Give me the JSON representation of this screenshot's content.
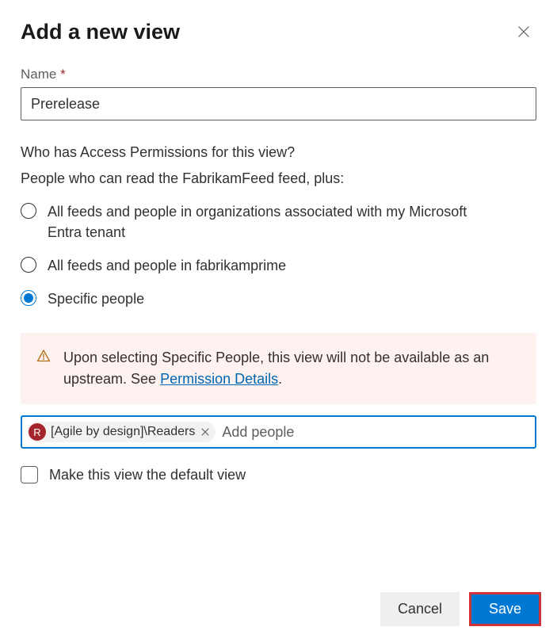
{
  "dialog": {
    "title": "Add a new view"
  },
  "nameField": {
    "label": "Name",
    "requiredMark": "*",
    "value": "Prerelease"
  },
  "permissions": {
    "question": "Who has Access Permissions for this view?",
    "subtext": "People who can read the FabrikamFeed feed, plus:",
    "options": {
      "opt0": {
        "label": "All feeds and people in organizations associated with my Microsoft Entra tenant",
        "checked": false
      },
      "opt1": {
        "label": "All feeds and people in fabrikamprime",
        "checked": false
      },
      "opt2": {
        "label": "Specific people",
        "checked": true
      }
    }
  },
  "infoBox": {
    "text": "Upon selecting Specific People, this view will not be available as an upstream. See ",
    "linkText": "Permission Details",
    "trailingText": "."
  },
  "peoplePicker": {
    "chip": {
      "avatarLetter": "R",
      "label": "[Agile by design]\\Readers"
    },
    "placeholder": "Add people"
  },
  "defaultView": {
    "label": "Make this view the default view",
    "checked": false
  },
  "footer": {
    "cancel": "Cancel",
    "save": "Save"
  }
}
